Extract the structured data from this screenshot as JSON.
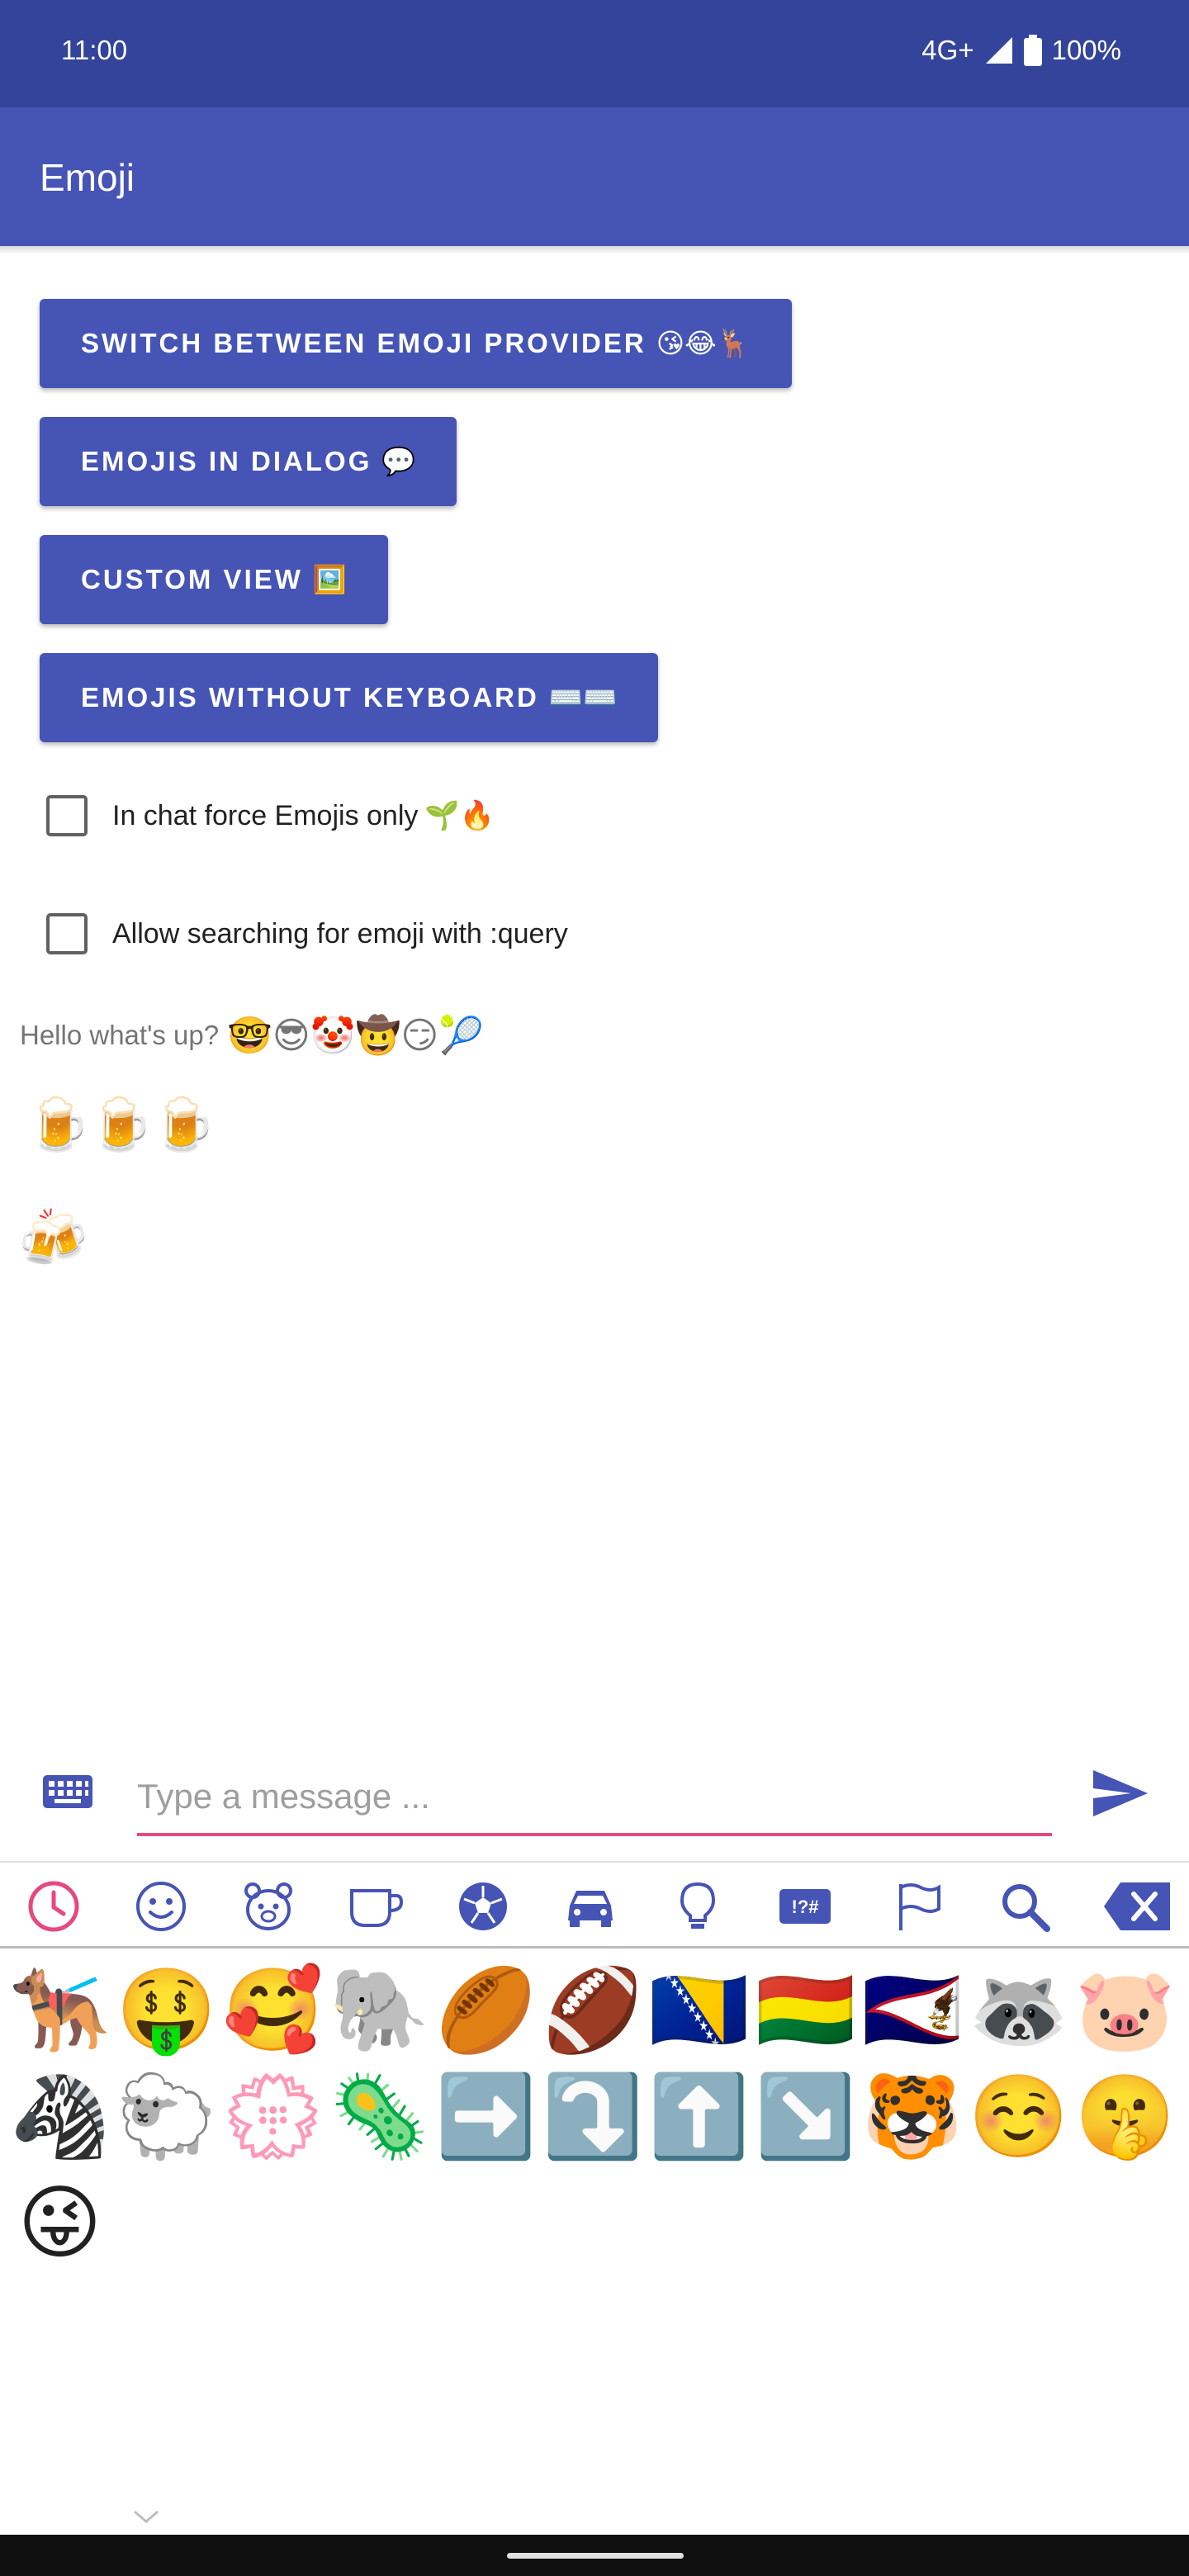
{
  "status_bar": {
    "time": "11:00",
    "network": "4G+",
    "battery": "100%"
  },
  "app_bar": {
    "title": "Emoji"
  },
  "buttons": [
    {
      "label": "SWITCH BETWEEN EMOJI PROVIDER",
      "emoji": "😘😂🦌"
    },
    {
      "label": "EMOJIS IN DIALOG",
      "emoji": "💬"
    },
    {
      "label": "CUSTOM VIEW",
      "emoji": "🖼️"
    },
    {
      "label": "EMOJIS WITHOUT KEYBOARD",
      "emoji": "⌨️⌨️"
    }
  ],
  "checkboxes": [
    {
      "label": "In chat force Emojis only",
      "emoji": "🌱🔥",
      "checked": false
    },
    {
      "label": "Allow searching for emoji with :query",
      "emoji": "",
      "checked": false
    }
  ],
  "chat": {
    "message_text": "Hello what's up?",
    "message_emoji": "🤓😎🤡🤠😏🎾",
    "beer_row": [
      "🍺",
      "🍺",
      "🍺"
    ],
    "cheers": "🍻"
  },
  "composer": {
    "placeholder": "Type a message ...",
    "value": ""
  },
  "accent_color": "#4554b5",
  "status_bar_color": "#33449a",
  "highlight_color": "#e5497f",
  "categories": [
    {
      "icon": "recent-clock-icon",
      "selected": true
    },
    {
      "icon": "smiley-icon",
      "selected": false
    },
    {
      "icon": "bear-icon",
      "selected": false
    },
    {
      "icon": "cup-icon",
      "selected": false
    },
    {
      "icon": "soccer-ball-icon",
      "selected": false
    },
    {
      "icon": "car-icon",
      "selected": false
    },
    {
      "icon": "lightbulb-icon",
      "selected": false
    },
    {
      "icon": "symbols-icon",
      "selected": false
    },
    {
      "icon": "flag-icon",
      "selected": false
    },
    {
      "icon": "search-icon",
      "selected": false
    },
    {
      "icon": "backspace-icon",
      "selected": false
    }
  ],
  "symbols_label": "!?#",
  "emoji_grid": [
    [
      "🐕‍🦺",
      "🤑",
      "🥰",
      "🐘",
      "🏉",
      "🏈",
      "🇧🇦",
      "🇧🇴",
      "🇦🇸",
      "🦝",
      "🐷"
    ],
    [
      "🦓",
      "🐑",
      "💮",
      "🦠",
      "➡️",
      "⤵️",
      "⬆️",
      "↘️",
      "🐯",
      "☺️",
      "🤫"
    ],
    [
      "😜"
    ]
  ]
}
